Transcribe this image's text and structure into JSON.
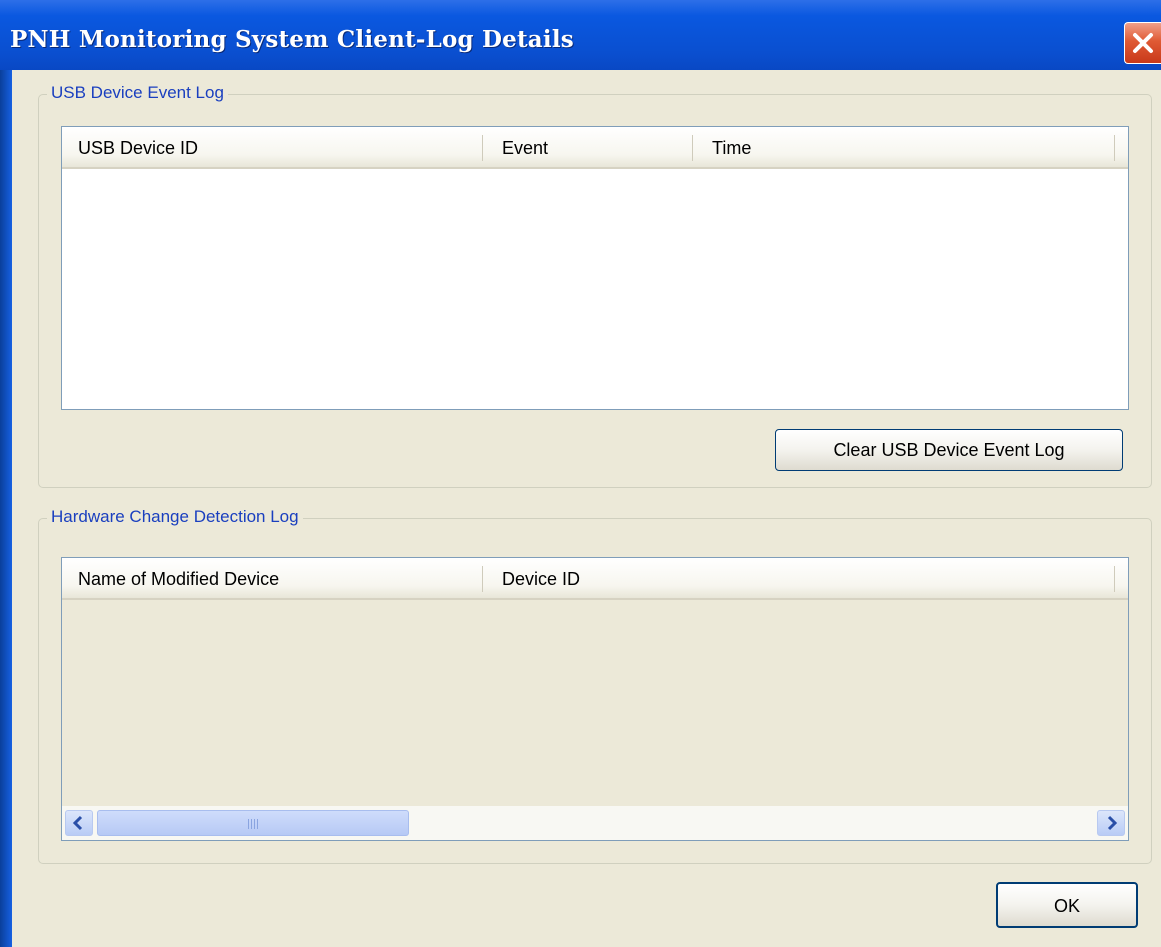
{
  "window": {
    "title": "PNH Monitoring System Client-Log Details",
    "close_icon": "close-icon"
  },
  "usb_group": {
    "legend": "USB Device Event Log",
    "columns": [
      "USB Device ID",
      "Event",
      "Time"
    ],
    "rows": [],
    "clear_button": "Clear USB Device Event Log"
  },
  "hw_group": {
    "legend": "Hardware Change Detection Log",
    "columns": [
      "Name of Modified Device",
      "Device ID"
    ],
    "rows": []
  },
  "ok_button": "OK",
  "colors": {
    "titlebar": "#0a58e0",
    "client_bg": "#ece9d8",
    "legend_text": "#1a3fbf",
    "close_button": "#e05a34"
  }
}
